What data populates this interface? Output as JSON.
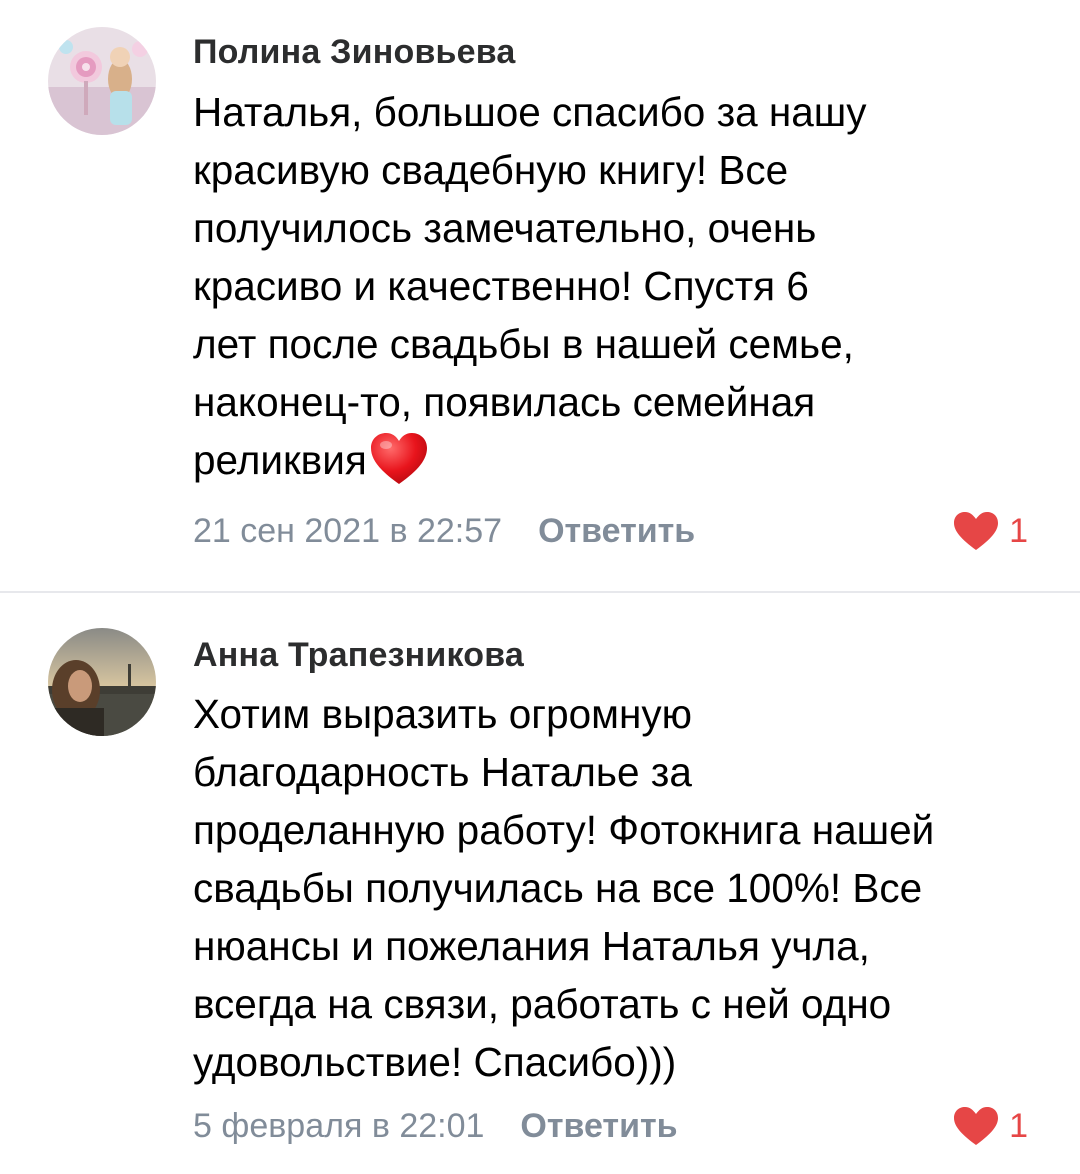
{
  "comments": [
    {
      "author": "Полина Зиновьева",
      "text_lines": "Наталья, большое спасибо за нашу\nкрасивую свадебную книгу! Все\nполучилось замечательно, очень\nкрасиво и качественно! Спустя 6\nлет после свадьбы в нашей семье,\nнаконец-то, появилась семейная\nреликвия",
      "emoji": "red-heart",
      "date": "21 сен 2021 в 22:57",
      "reply_label": "Ответить",
      "likes": "1"
    },
    {
      "author": "Анна Трапезникова",
      "text_lines": "Хотим выразить огромную\nблагодарность Наталье за\nпроделанную работу! Фотокнига нашей\nсвадьбы получилась на все 100%! Все\nнюансы и пожелания Наталья учла,\nвсегда на связи, работать с ней одно\nудовольствие! Спасибо)))",
      "date": "5 февраля в 22:01",
      "reply_label": "Ответить",
      "likes": "1"
    }
  ],
  "colors": {
    "like_red": "#e64646",
    "meta_gray": "#818c99",
    "divider": "#e7e8ec"
  }
}
